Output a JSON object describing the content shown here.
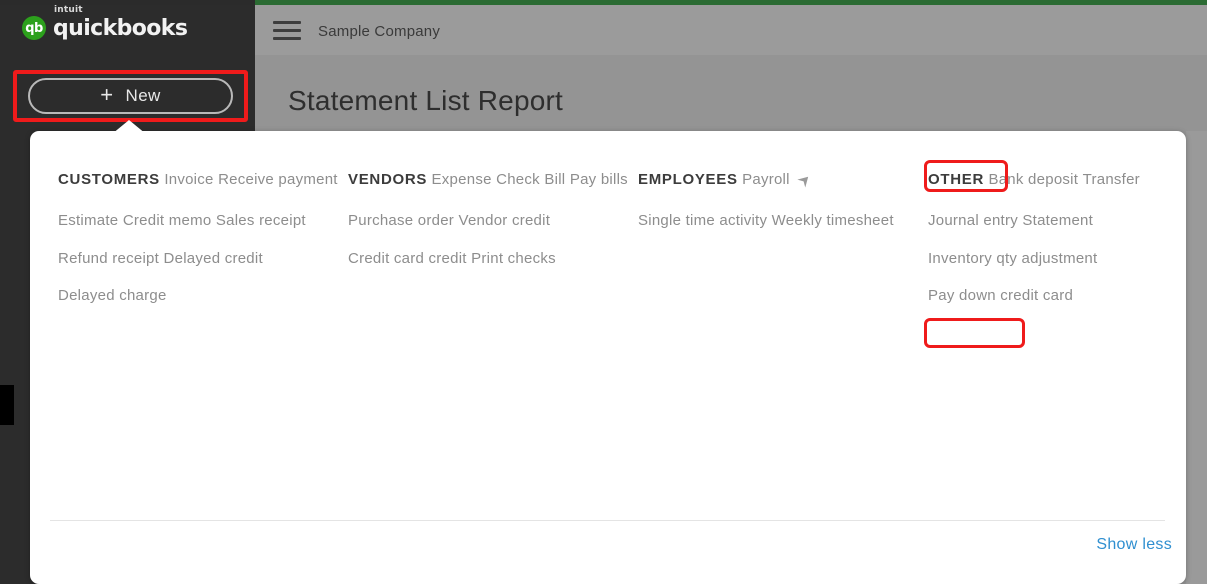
{
  "brand": {
    "badge_text": "qb",
    "intuit_text": "intuit",
    "product_text": "quickbooks",
    "green": "#2ca01c"
  },
  "sidebar": {
    "new_button": {
      "plus_glyph": "+",
      "label": "New"
    }
  },
  "header": {
    "menu_icon": "hamburger-icon",
    "company_name": "Sample Company",
    "page_title": "Statement List Report"
  },
  "panel": {
    "columns": [
      {
        "title": "CUSTOMERS",
        "items": [
          {
            "label": "Invoice"
          },
          {
            "label": "Receive payment"
          },
          {
            "label": "Estimate"
          },
          {
            "label": "Credit memo"
          },
          {
            "label": "Sales receipt"
          },
          {
            "label": "Refund receipt"
          },
          {
            "label": "Delayed credit"
          },
          {
            "label": "Delayed charge"
          }
        ]
      },
      {
        "title": "VENDORS",
        "items": [
          {
            "label": "Expense"
          },
          {
            "label": "Check"
          },
          {
            "label": "Bill"
          },
          {
            "label": "Pay bills"
          },
          {
            "label": "Purchase order"
          },
          {
            "label": "Vendor credit"
          },
          {
            "label": "Credit card credit"
          },
          {
            "label": "Print checks"
          }
        ]
      },
      {
        "title": "EMPLOYEES",
        "items": [
          {
            "label": "Payroll",
            "icon": "rocket-arrow-icon",
            "icon_glyph": "⮝"
          },
          {
            "label": "Single time activity"
          },
          {
            "label": "Weekly timesheet"
          }
        ]
      },
      {
        "title": "OTHER",
        "items": [
          {
            "label": "Bank deposit"
          },
          {
            "label": "Transfer"
          },
          {
            "label": "Journal entry"
          },
          {
            "label": "Statement"
          },
          {
            "label": "Inventory qty adjustment"
          },
          {
            "label": "Pay down credit card"
          }
        ]
      }
    ],
    "show_less_label": "Show less"
  },
  "annotations": {
    "color": "#ef1b1b",
    "boxes": [
      {
        "target": "new-button"
      },
      {
        "target": "other-column-title"
      },
      {
        "target": "statement-menu-item"
      }
    ]
  }
}
